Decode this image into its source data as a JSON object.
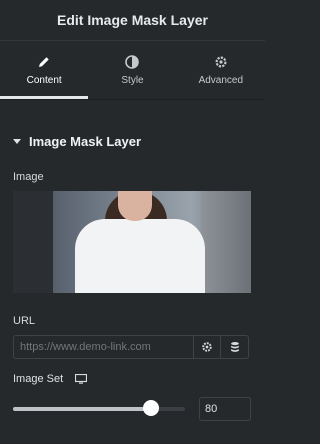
{
  "header": {
    "title": "Edit Image Mask Layer"
  },
  "tabs": [
    {
      "label": "Content",
      "icon": "pencil-icon",
      "active": true
    },
    {
      "label": "Style",
      "icon": "half-circle-icon",
      "active": false
    },
    {
      "label": "Advanced",
      "icon": "gear-icon",
      "active": false
    }
  ],
  "section": {
    "title": "Image Mask Layer",
    "image_label": "Image",
    "url_label": "URL",
    "url_placeholder": "https://www.demo-link.com",
    "image_set_label": "Image Set",
    "slider_value": "80",
    "slider_fraction": 0.8
  }
}
